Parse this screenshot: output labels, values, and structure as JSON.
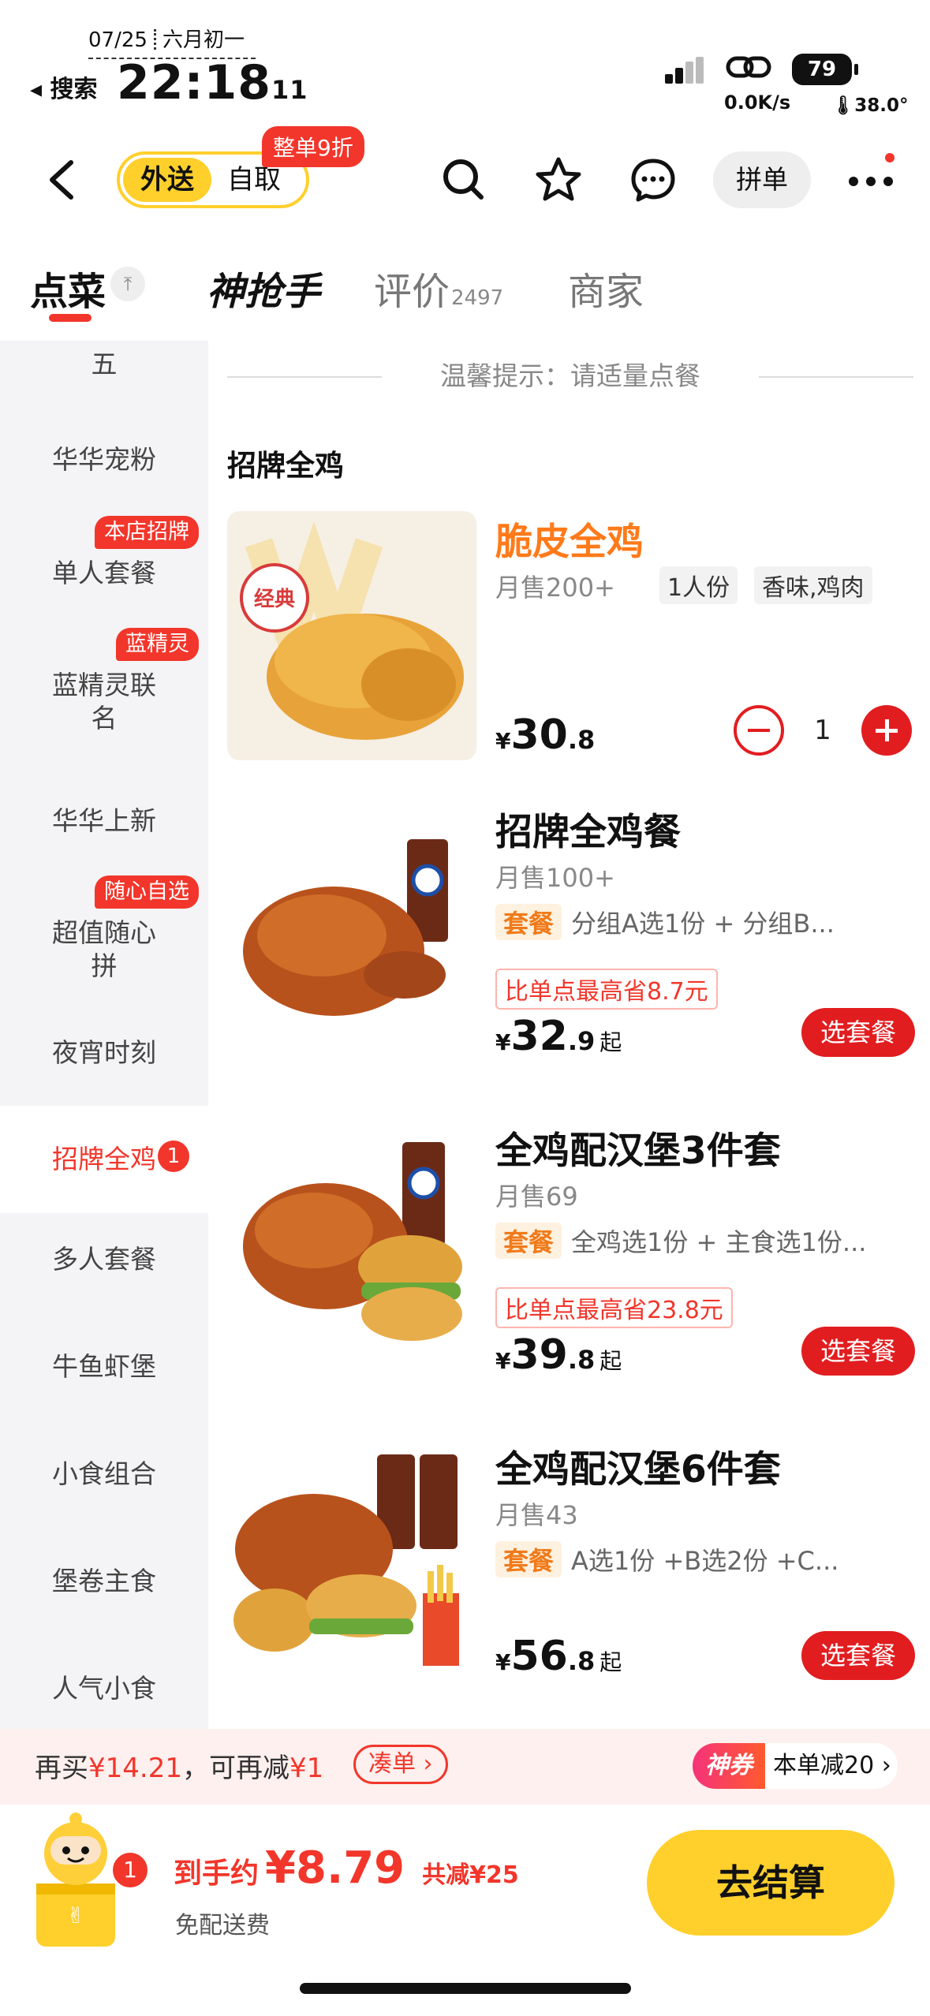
{
  "status_bar": {
    "date": "07/25",
    "lunar": "六月初一",
    "back_app": "搜索",
    "time_main": "22:18",
    "time_sec": "11",
    "battery": "79",
    "net_speed": "0.0K/s",
    "temperature": "38.0°"
  },
  "nav": {
    "delivery_label": "外送",
    "pickup_label": "自取",
    "promo_badge": "整单9折",
    "group_order_label": "拼单"
  },
  "tabs": {
    "order": "点菜",
    "flash": "神抢手",
    "reviews": "评价",
    "reviews_count": "2497",
    "merchant": "商家"
  },
  "sidebar": {
    "items": [
      {
        "label": "五"
      },
      {
        "label": "华华宠粉"
      },
      {
        "label": "单人套餐",
        "badge": "本店招牌"
      },
      {
        "label": "蓝精灵联名",
        "badge": "蓝精灵"
      },
      {
        "label": "华华上新"
      },
      {
        "label": "超值随心拼",
        "badge": "随心自选"
      },
      {
        "label": "夜宵时刻"
      },
      {
        "label": "招牌全鸡",
        "count": "1"
      },
      {
        "label": "多人套餐"
      },
      {
        "label": "牛鱼虾堡"
      },
      {
        "label": "小食组合"
      },
      {
        "label": "堡卷主食"
      },
      {
        "label": "人气小食"
      }
    ]
  },
  "main": {
    "hint": "温馨提示：请适量点餐",
    "section_title": "招牌全鸡",
    "items": [
      {
        "name": "脆皮全鸡",
        "sold": "月售200+",
        "chip1": "1人份",
        "chip2": "香味,鸡肉",
        "price_symbol": "¥",
        "price_big": "30",
        "price_small": ".8",
        "qty": "1",
        "stamp": "经典"
      },
      {
        "name": "招牌全鸡餐",
        "sold": "月售100+",
        "set_tag": "套餐",
        "set_desc": "分组A选1份 + 分组B...",
        "save": "比单点最高省8.7元",
        "price_symbol": "¥",
        "price_big": "32",
        "price_small": ".9",
        "price_suffix": "起",
        "button": "选套餐"
      },
      {
        "name": "全鸡配汉堡3件套",
        "sold": "月售69",
        "set_tag": "套餐",
        "set_desc": "全鸡选1份 + 主食选1份...",
        "save": "比单点最高省23.8元",
        "price_symbol": "¥",
        "price_big": "39",
        "price_small": ".8",
        "price_suffix": "起",
        "button": "选套餐"
      },
      {
        "name": "全鸡配汉堡6件套",
        "sold": "月售43",
        "set_tag": "套餐",
        "set_desc": "A选1份 +B选2份 +C...",
        "price_symbol": "¥",
        "price_big": "56",
        "price_small": ".8",
        "price_suffix": "起",
        "button": "选套餐"
      }
    ]
  },
  "promo": {
    "buy_more_prefix": "再买",
    "buy_more_amount": "¥14.21",
    "buy_more_mid": "，可再减",
    "buy_more_discount": "¥1",
    "add_label": "凑单 ›",
    "shen_logo": "神券",
    "shen_text": "本单减20 ›"
  },
  "cart": {
    "count": "1",
    "total_label": "到手约",
    "total_value": "¥8.79",
    "discount": "共减¥25",
    "free_delivery": "免配送费",
    "checkout": "去结算"
  },
  "colors": {
    "accent_red": "#e21d20",
    "brand_yellow": "#ffd02c",
    "orange": "#ff7a1a"
  }
}
